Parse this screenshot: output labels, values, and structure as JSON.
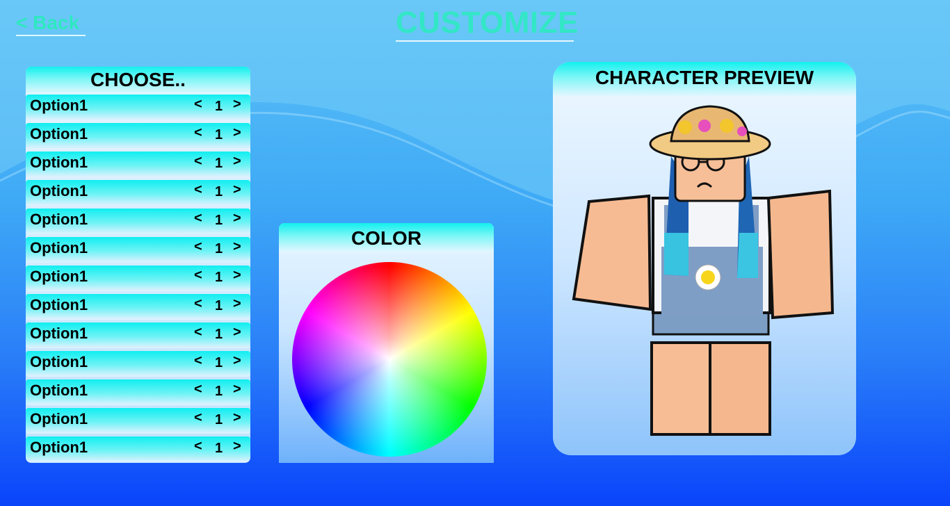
{
  "header": {
    "back_label": "< Back",
    "title": "CUSTOMIZE"
  },
  "choose_panel": {
    "title": "CHOOSE..",
    "options": [
      {
        "label": "Option1",
        "prev": "<",
        "value": "1",
        "next": ">"
      },
      {
        "label": "Option1",
        "prev": "<",
        "value": "1",
        "next": ">"
      },
      {
        "label": "Option1",
        "prev": "<",
        "value": "1",
        "next": ">"
      },
      {
        "label": "Option1",
        "prev": "<",
        "value": "1",
        "next": ">"
      },
      {
        "label": "Option1",
        "prev": "<",
        "value": "1",
        "next": ">"
      },
      {
        "label": "Option1",
        "prev": "<",
        "value": "1",
        "next": ">"
      },
      {
        "label": "Option1",
        "prev": "<",
        "value": "1",
        "next": ">"
      },
      {
        "label": "Option1",
        "prev": "<",
        "value": "1",
        "next": ">"
      },
      {
        "label": "Option1",
        "prev": "<",
        "value": "1",
        "next": ">"
      },
      {
        "label": "Option1",
        "prev": "<",
        "value": "1",
        "next": ">"
      },
      {
        "label": "Option1",
        "prev": "<",
        "value": "1",
        "next": ">"
      },
      {
        "label": "Option1",
        "prev": "<",
        "value": "1",
        "next": ">"
      },
      {
        "label": "Option1",
        "prev": "<",
        "value": "1",
        "next": ">"
      }
    ]
  },
  "color_panel": {
    "title": "COLOR",
    "wheel_icon": "color-wheel"
  },
  "preview_panel": {
    "title": "CHARACTER PREVIEW",
    "avatar_icon": "blocky-character-avatar"
  },
  "colors": {
    "title_accent": "#33e6c6",
    "row_top": "#10eef0",
    "background_bottom": "#0a44fb"
  }
}
